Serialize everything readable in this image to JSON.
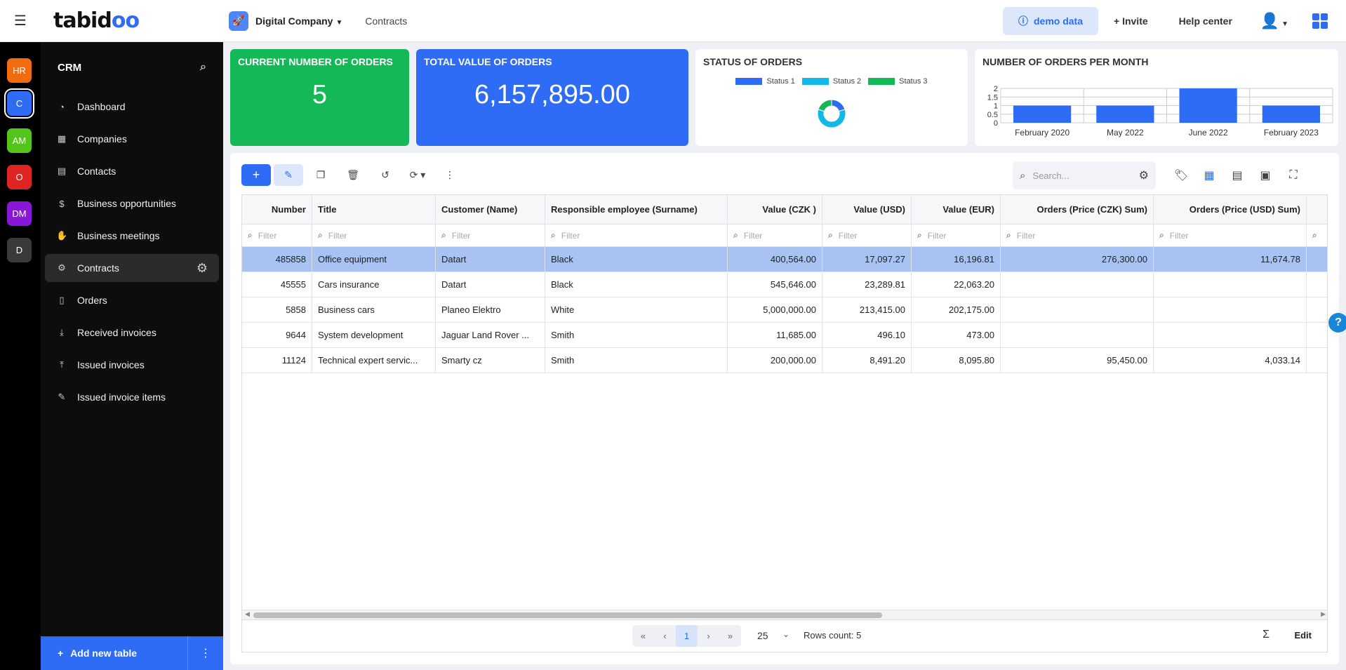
{
  "app": {
    "logo_text": "tabidoo"
  },
  "topbar": {
    "company": "Digital Company",
    "breadcrumb": "Contracts",
    "demo_label": "demo data",
    "invite_label": "Invite",
    "help_label": "Help center"
  },
  "rail": [
    {
      "label": "HR",
      "color": "#f26b0f"
    },
    {
      "label": "C",
      "color": "#2e6cf6"
    },
    {
      "label": "AM",
      "color": "#52c41a"
    },
    {
      "label": "O",
      "color": "#e02424"
    },
    {
      "label": "DM",
      "color": "#8a16d8"
    },
    {
      "label": "D",
      "color": "#3a3a3a"
    }
  ],
  "sidebar": {
    "title": "CRM",
    "items": [
      {
        "label": "Dashboard",
        "icon": "pie-chart-icon"
      },
      {
        "label": "Companies",
        "icon": "building-icon"
      },
      {
        "label": "Contacts",
        "icon": "contact-card-icon"
      },
      {
        "label": "Business opportunities",
        "icon": "dollar-icon"
      },
      {
        "label": "Business meetings",
        "icon": "handshake-icon"
      },
      {
        "label": "Contracts",
        "icon": "settings-icon"
      },
      {
        "label": "Orders",
        "icon": "document-icon"
      },
      {
        "label": "Received invoices",
        "icon": "download-icon"
      },
      {
        "label": "Issued invoices",
        "icon": "upload-icon"
      },
      {
        "label": "Issued invoice items",
        "icon": "edit-icon"
      }
    ],
    "add_table_label": "Add new table"
  },
  "widgets": {
    "orders_count": {
      "title": "CURRENT NUMBER OF ORDERS",
      "value": "5"
    },
    "orders_value": {
      "title": "TOTAL VALUE OF ORDERS",
      "value": "6,157,895.00"
    },
    "status": {
      "title": "STATUS OF ORDERS",
      "legend": [
        {
          "name": "Status 1",
          "color": "#2e6cf6"
        },
        {
          "name": "Status 2",
          "color": "#14b8e6"
        },
        {
          "name": "Status 3",
          "color": "#15b857"
        }
      ]
    },
    "per_month": {
      "title": "NUMBER OF ORDERS PER MONTH"
    }
  },
  "chart_data": [
    {
      "type": "pie",
      "labels": [
        "Status 1",
        "Status 2",
        "Status 3"
      ],
      "values": [
        1,
        3,
        1
      ]
    },
    {
      "type": "bar",
      "categories": [
        "February 2020",
        "May 2022",
        "June 2022",
        "February 2023"
      ],
      "values": [
        1,
        1,
        2,
        1
      ],
      "ylim": [
        0,
        2
      ],
      "yticks": [
        "2",
        "1.5",
        "1",
        "0.5",
        "0"
      ]
    }
  ],
  "search": {
    "placeholder": "Search..."
  },
  "table": {
    "filter_placeholder": "Filter",
    "columns": [
      "Number",
      "Title",
      "Customer (Name)",
      "Responsible employee (Surname)",
      "Value (CZK )",
      "Value (USD)",
      "Value (EUR)",
      "Orders (Price (CZK) Sum)",
      "Orders (Price (USD) Sum)"
    ],
    "rows": [
      [
        "485858",
        "Office equipment",
        "Datart",
        "Black",
        "400,564.00",
        "17,097.27",
        "16,196.81",
        "276,300.00",
        "11,674.78"
      ],
      [
        "45555",
        "Cars insurance",
        "Datart",
        "Black",
        "545,646.00",
        "23,289.81",
        "22,063.20",
        "",
        ""
      ],
      [
        "5858",
        "Business cars",
        "Planeo Elektro",
        "White",
        "5,000,000.00",
        "213,415.00",
        "202,175.00",
        "",
        ""
      ],
      [
        "9644",
        "System development",
        "Jaguar Land Rover ...",
        "Smith",
        "11,685.00",
        "496.10",
        "473.00",
        "",
        ""
      ],
      [
        "11124",
        "Technical expert servic...",
        "Smarty cz",
        "Smith",
        "200,000.00",
        "8,491.20",
        "8,095.80",
        "95,450.00",
        "4,033.14"
      ]
    ]
  },
  "pager": {
    "current_page": "1",
    "page_size": "25",
    "rows_count": "Rows count: 5",
    "edit_label": "Edit"
  }
}
